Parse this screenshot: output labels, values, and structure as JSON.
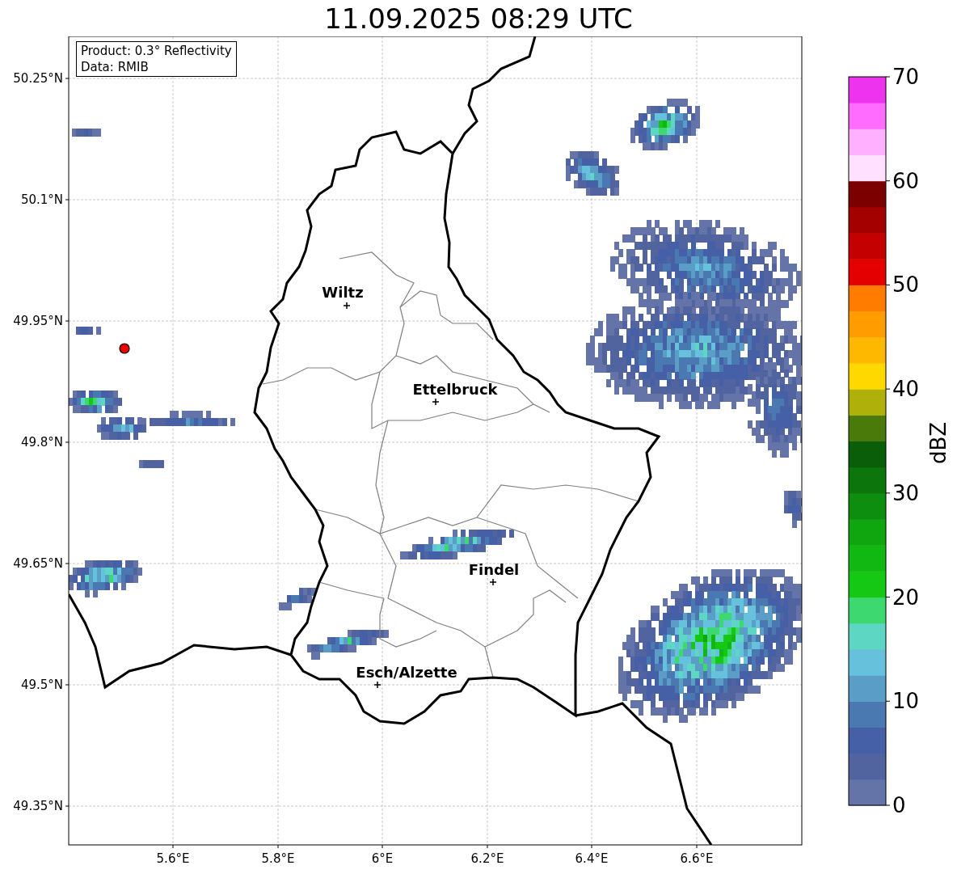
{
  "title": "11.09.2025 08:29 UTC",
  "info_box": {
    "lines": [
      "Product: 0.3° Reflectivity",
      "Data: RMIB"
    ]
  },
  "map": {
    "lat_ticks": [
      "50.25°N",
      "50.1°N",
      "49.95°N",
      "49.8°N",
      "49.65°N",
      "49.5°N",
      "49.35°N"
    ],
    "lon_ticks": [
      "5.6°E",
      "5.8°E",
      "6°E",
      "6.2°E",
      "6.4°E",
      "6.6°E"
    ],
    "places": [
      {
        "label": "Wiltz"
      },
      {
        "label": "Ettelbruck"
      },
      {
        "label": "Findel"
      },
      {
        "label": "Esch/Alzette"
      }
    ]
  },
  "colorbar": {
    "label": "dBZ",
    "ticks": [
      "70",
      "60",
      "50",
      "40",
      "30",
      "20",
      "10",
      "0"
    ]
  }
}
